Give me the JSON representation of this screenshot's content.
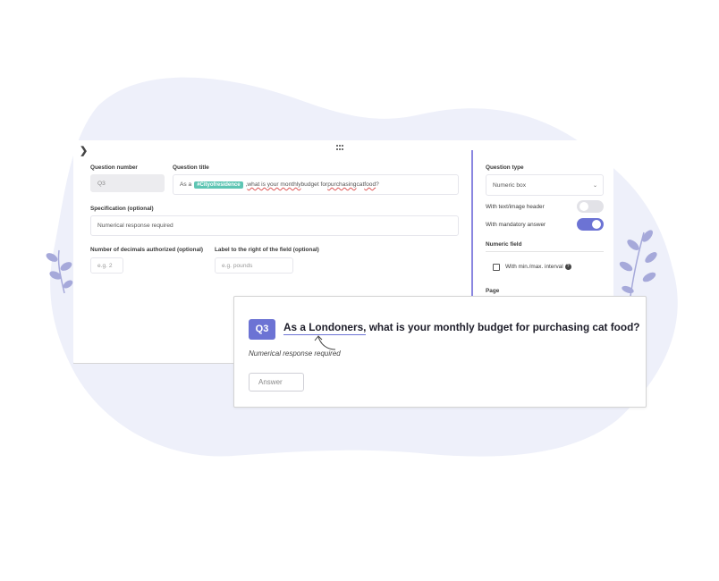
{
  "colors": {
    "blob": "#eef0fa",
    "leaf": "#a6a9da",
    "accent": "#6c73d4",
    "tag": "#5ec5b3",
    "toggle_off": "#e2e2e7",
    "toggle_on": "#6c73d4"
  },
  "editor": {
    "question_number": {
      "label": "Question number",
      "value": "Q3"
    },
    "question_title": {
      "label": "Question title",
      "prefix": "As a",
      "tag": "#Cityofresidence",
      "suffix_plain1": ", ",
      "suffix_u1": "what is your monthly",
      "suffix_plain2": " budget for ",
      "suffix_u2": "purchasing",
      "suffix_plain3": " cat ",
      "suffix_u3": "food",
      "suffix_plain4": "?"
    },
    "specification": {
      "label": "Specification (optional)",
      "value": "Numerical response required"
    },
    "decimals": {
      "label": "Number of decimals authorized (optional)",
      "placeholder": "e.g. 2"
    },
    "label_right": {
      "label": "Label to the right of the field (optional)",
      "placeholder": "e.g. pounds"
    }
  },
  "sidebar": {
    "question_type": {
      "label": "Question type",
      "value": "Numeric box"
    },
    "with_header": {
      "label": "With text/image header",
      "on": false
    },
    "mandatory": {
      "label": "With mandatory answer",
      "on": true
    },
    "numeric_field": {
      "label": "Numeric field"
    },
    "minmax": {
      "label": "With min./max. interval"
    },
    "page": {
      "label": "Page"
    }
  },
  "preview": {
    "badge": "Q3",
    "title_piped": "As a Londoners,",
    "title_rest": " what is your monthly budget for purchasing cat food?",
    "specification": "Numerical response required",
    "answer_placeholder": "Answer"
  }
}
